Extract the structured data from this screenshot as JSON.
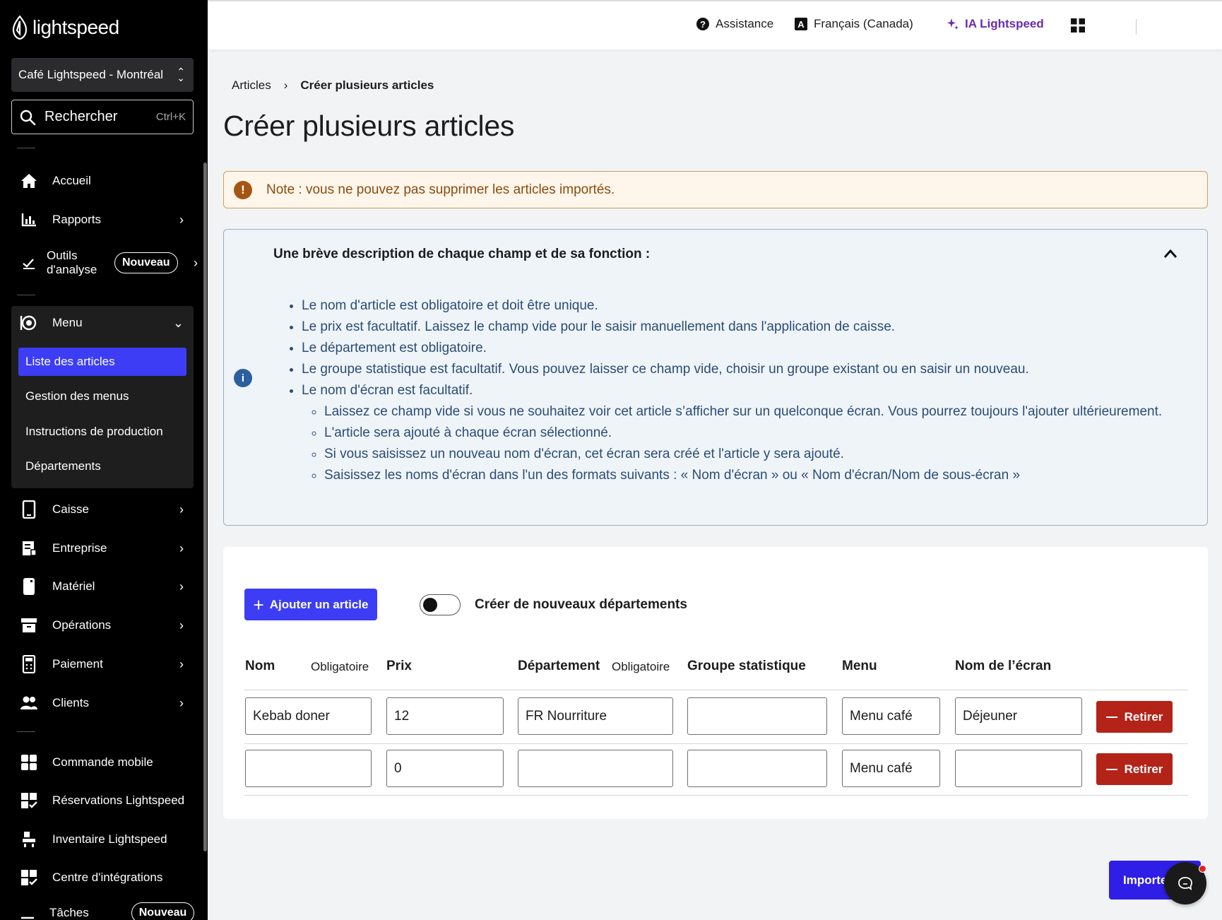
{
  "brand": {
    "logo_text": "lightspeed",
    "accent": "#3d3df5",
    "danger": "#b42318"
  },
  "sidebar": {
    "store": "Café Lightspeed - Montréal",
    "search": {
      "label": "Rechercher",
      "shortcut": "Ctrl+K"
    },
    "items": [
      {
        "label": "Accueil",
        "icon": "home-icon"
      },
      {
        "label": "Rapports",
        "icon": "bar-chart-icon"
      },
      {
        "label": "Outils d'analyse",
        "badge": "Nouveau",
        "icon": "analytics-icon"
      },
      {
        "label": "Menu",
        "icon": "menu-icon"
      },
      {
        "label": "Caisse",
        "icon": "tablet-icon"
      },
      {
        "label": "Entreprise",
        "icon": "business-icon"
      },
      {
        "label": "Matériel",
        "icon": "device-icon"
      },
      {
        "label": "Opérations",
        "icon": "archive-icon"
      },
      {
        "label": "Paiement",
        "icon": "payment-icon"
      },
      {
        "label": "Clients",
        "icon": "users-icon"
      },
      {
        "label": "Commande mobile",
        "icon": "mobile-order-icon"
      },
      {
        "label": "Réservations Lightspeed",
        "icon": "reservations-icon"
      },
      {
        "label": "Inventaire Lightspeed",
        "icon": "inventory-icon"
      },
      {
        "label": "Centre d'intégrations",
        "icon": "integrations-icon"
      },
      {
        "label": "Tâches",
        "badge": "Nouveau",
        "icon": "tasks-icon"
      }
    ],
    "menu_sub": [
      "Liste des articles",
      "Gestion des menus",
      "Instructions de production",
      "Départements"
    ]
  },
  "topbar": {
    "help": "Assistance",
    "language": "Français (Canada)",
    "ai": "IA Lightspeed"
  },
  "breadcrumb": {
    "parent": "Articles",
    "current": "Créer plusieurs articles"
  },
  "page": {
    "title": "Créer plusieurs articles"
  },
  "note": "Note : vous ne pouvez pas supprimer les articles importés.",
  "info": {
    "heading": "Une brève description de chaque champ et de sa fonction :",
    "bullets": [
      "Le nom d'article est obligatoire et doit être unique.",
      "Le prix est facultatif. Laissez le champ vide pour le saisir manuellement dans l'application de caisse.",
      "Le département est obligatoire.",
      "Le groupe statistique est facultatif. Vous pouvez laisser ce champ vide, choisir un groupe existant ou en saisir un nouveau.",
      "Le nom d'écran est facultatif."
    ],
    "sub_bullets": [
      "Laissez ce champ vide si vous ne souhaitez voir cet article s’afficher sur un quelconque écran. Vous pourrez toujours l'ajouter ultérieurement.",
      "L'article sera ajouté à chaque écran sélectionné.",
      "Si vous saisissez un nouveau nom d'écran, cet écran sera créé et l'article y sera ajouté.",
      "Saisissez les noms d'écran dans l'un des formats suivants : « Nom d'écran » ou « Nom d'écran/Nom de sous-écran »"
    ]
  },
  "form": {
    "add_button": "Ajouter un article",
    "toggle_label": "Créer de nouveaux départements",
    "toggle_on": false,
    "columns": {
      "name": "Nom",
      "name_required": "Obligatoire",
      "price": "Prix",
      "department": "Département",
      "department_required": "Obligatoire",
      "stat_group": "Groupe statistique",
      "menu": "Menu",
      "screen": "Nom de l’écran"
    },
    "rows": [
      {
        "name": "Kebab doner",
        "price": "12",
        "department": "FR Nourriture",
        "stat_group": "",
        "menu": "Menu café",
        "screen": "Déjeuner"
      },
      {
        "name": "",
        "price": "0",
        "department": "",
        "stat_group": "",
        "menu": "Menu café",
        "screen": ""
      }
    ],
    "remove_label": "Retirer"
  },
  "import_button": "Importer"
}
